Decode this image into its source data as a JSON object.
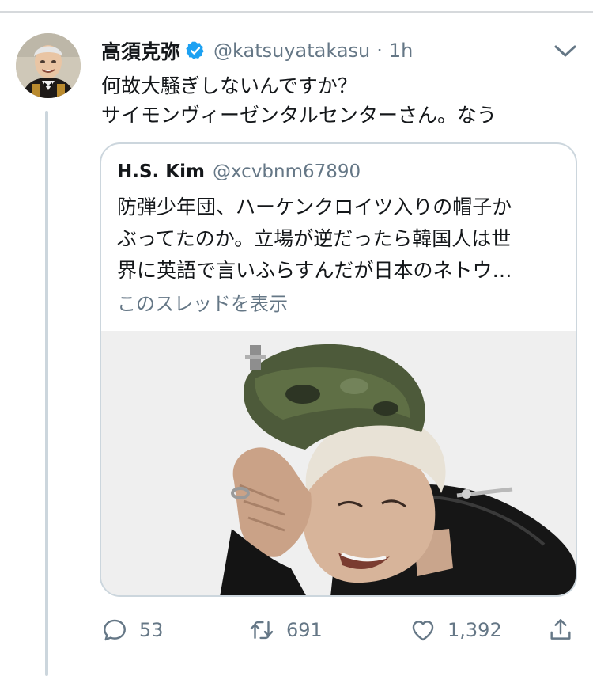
{
  "tweet": {
    "display_name": "高須克弥",
    "handle": "@katsuyatakasu",
    "separator": "·",
    "timestamp": "1h",
    "text_lines": [
      "何故大騒ぎしないんですか？",
      "サイモンヴィーゼンタルセンターさん。なう"
    ],
    "verified": true
  },
  "quoted_tweet": {
    "display_name": "H.S. Kim",
    "handle": "@xcvbnm67890",
    "text_lines": [
      "防弾少年団、ハーケンクロイツ入りの帽子か",
      "ぶってたのか。立場が逆だったら韓国人は世",
      "界に英語で言いふらすんだが日本のネトウ…"
    ],
    "show_thread_label": "このスレッドを表示"
  },
  "actions": {
    "reply_count": "53",
    "retweet_count": "691",
    "like_count": "1,392"
  },
  "colors": {
    "accent": "#1da1f2",
    "secondary_text": "#657786",
    "border": "#ccd6dd"
  },
  "icons": [
    "verified-badge-icon",
    "chevron-down-icon",
    "reply-icon",
    "retweet-icon",
    "like-icon",
    "share-icon"
  ]
}
